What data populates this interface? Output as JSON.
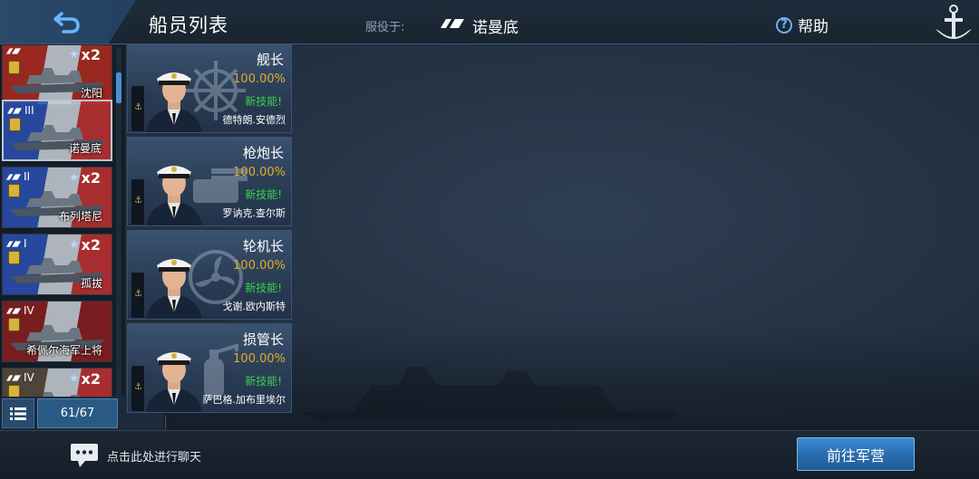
{
  "header": {
    "title": "船员列表",
    "service_label": "服役于:",
    "ship_name": "诺曼底",
    "help_label": "帮助",
    "help_icon": "?"
  },
  "ships": [
    {
      "name": "沈阳",
      "tier": "",
      "multiplier": "x2",
      "flag_color": "#b02a1e"
    },
    {
      "name": "诺曼底",
      "tier": "III",
      "multiplier": "",
      "flag_color": "#2a4fb0"
    },
    {
      "name": "布列塔尼",
      "tier": "II",
      "multiplier": "x2",
      "flag_color": "#2a4fb0"
    },
    {
      "name": "孤拔",
      "tier": "I",
      "multiplier": "x2",
      "flag_color": "#2a4fb0"
    },
    {
      "name": "希佩尔海军上将",
      "tier": "IV",
      "multiplier": "",
      "flag_color": "#8a1e1e"
    },
    {
      "name": "",
      "tier": "IV",
      "multiplier": "x2",
      "flag_color": "#5a4a3a"
    }
  ],
  "list_counter": "61/67",
  "crew": [
    {
      "role": "舰长",
      "percent": "100.00%",
      "skill": "新技能!",
      "name": "德特朗.安德烈",
      "deco": "wheel-icon"
    },
    {
      "role": "枪炮长",
      "percent": "100.00%",
      "skill": "新技能!",
      "name": "罗讷克.查尔斯",
      "deco": "turret-icon"
    },
    {
      "role": "轮机长",
      "percent": "100.00%",
      "skill": "新技能!",
      "name": "戈谢.欧内斯特",
      "deco": "propeller-icon"
    },
    {
      "role": "损管长",
      "percent": "100.00%",
      "skill": "新技能!",
      "name": "萨巴格.加布里埃尔",
      "deco": "extinguisher-icon"
    }
  ],
  "footer": {
    "chat_label": "点击此处进行聊天",
    "goto_button": "前往军营"
  },
  "colors": {
    "accent": "#4a8fd6",
    "percent": "#e2ac2c",
    "skill": "#39d24a"
  }
}
